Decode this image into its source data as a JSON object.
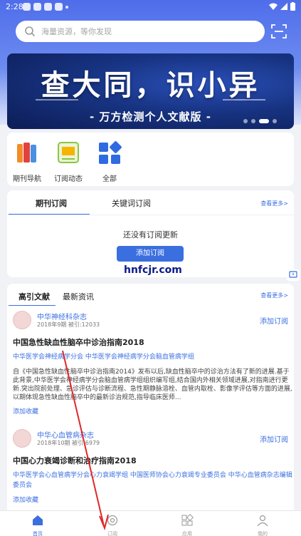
{
  "status_bar": {
    "time": "2:28"
  },
  "search": {
    "placeholder": "海量资源，等你发现"
  },
  "banner": {
    "title": "查大同，识小异",
    "subtitle": "- 万方检测个人文献版 -"
  },
  "quick_links": [
    {
      "label": "期刊导航",
      "icon": "journal-nav-icon"
    },
    {
      "label": "订阅动态",
      "icon": "subscription-feed-icon"
    },
    {
      "label": "全部",
      "icon": "all-apps-icon"
    }
  ],
  "subscription": {
    "tabs": [
      "期刊订阅",
      "关键词订阅"
    ],
    "more": "查看更多>",
    "empty_text": "还没有订阅更新",
    "add_button": "添加订阅"
  },
  "watermark": "hnfcjr.com",
  "literature": {
    "tabs": [
      "高引文献",
      "最新资讯"
    ],
    "more": "查看更多>",
    "articles": [
      {
        "journal": "中华神经科杂志",
        "meta": "2018年9期   被引:12033",
        "subscribe": "添加订阅",
        "title": "中国急性缺血性脑卒中诊治指南2018",
        "authors": "中华医学会神经病学分会  中华医学会神经病学分会脑血管病学组",
        "abstract": "自《中国急性缺血性脑卒中诊治指南2014》发布以后,缺血性脑卒中的诊治方法有了新的进展.基于此背景,中华医学会神经病学分会脑血管病学组组织编写组,结合国内外相关领域进展,对指南进行更新.突出院前处理、急诊评估与诊断流程、急性期静脉溶栓、血管内取栓、影像学评估等方面的进展,以期体现急性缺血性脑卒中的最新诊治规范,指导临床医师...",
        "collect": "添加收藏"
      },
      {
        "journal": "中华心血管病杂志",
        "meta": "2018年10期   被引:6979",
        "subscribe": "添加订阅",
        "title": "中国心力衰竭诊断和治疗指南2018",
        "authors": "中华医学会心血管病学分会心力衰竭学组  中国医师协会心力衰竭专业委员会  中华心血管病杂志编辑委员会",
        "collect": "添加收藏"
      }
    ]
  },
  "bottom_nav": [
    {
      "label": "首页",
      "active": true
    },
    {
      "label": "订阅",
      "active": false
    },
    {
      "label": "应用",
      "active": false
    },
    {
      "label": "我的",
      "active": false
    }
  ],
  "colors": {
    "accent": "#3b6fe0",
    "header": "#4f6dea",
    "annotation_arrow": "#e0282a"
  }
}
